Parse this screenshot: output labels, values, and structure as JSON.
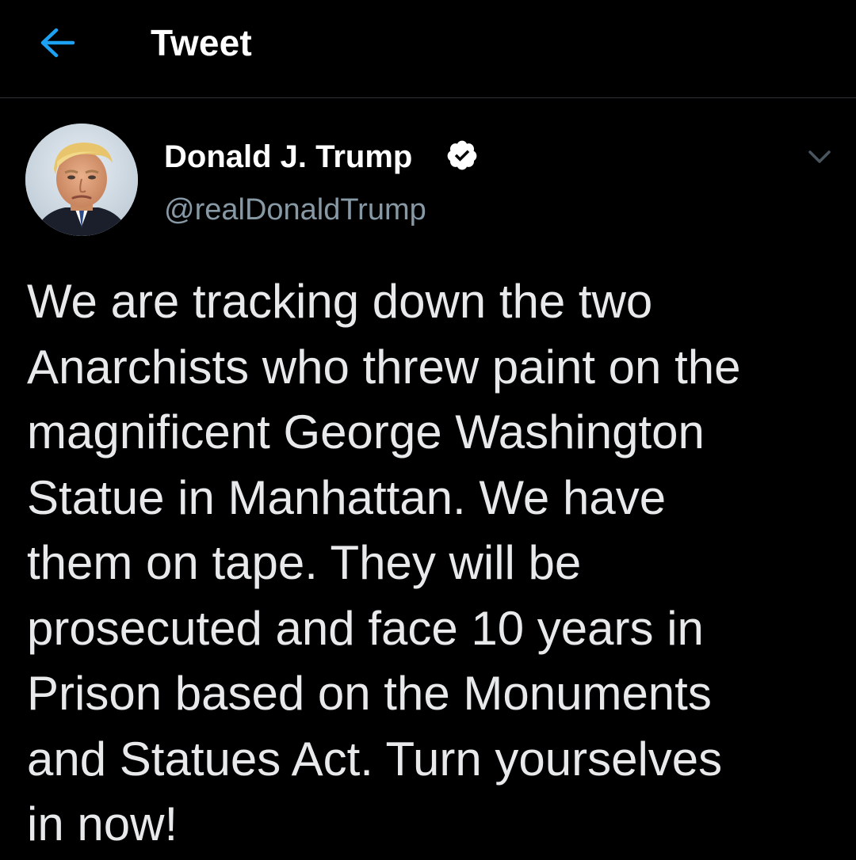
{
  "header": {
    "title": "Tweet",
    "back_icon": "arrow-left-icon",
    "accent_color": "#1da1f2"
  },
  "tweet": {
    "author": {
      "name": "Donald J. Trump",
      "handle": "@realDonaldTrump",
      "verified": true,
      "verified_icon": "verified-badge-icon",
      "avatar_icon": "avatar-photo"
    },
    "menu_icon": "chevron-down-icon",
    "text_lines": [
      "We are tracking down the two",
      "Anarchists who threw paint on the",
      "magnificent George Washington",
      "Statue in Manhattan. We have",
      "them on tape. They will be",
      "prosecuted and face 10 years in",
      "Prison based on the Monuments",
      "and Statues Act. Turn yourselves",
      "in now!"
    ]
  },
  "colors": {
    "background": "#000000",
    "text": "#e7e9ea",
    "secondary_text": "#8899a6",
    "divider": "#2f3336"
  }
}
